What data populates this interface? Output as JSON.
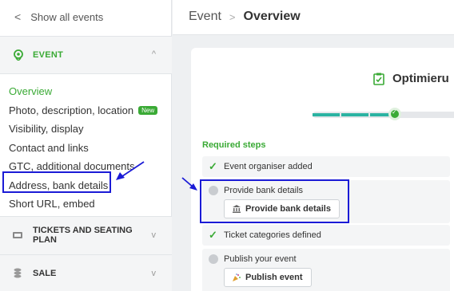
{
  "sidebar": {
    "back_label": "Show all events",
    "event_section": "EVENT",
    "menu": [
      {
        "label": "Overview",
        "active": true
      },
      {
        "label": "Photo, description, location",
        "badge": "New"
      },
      {
        "label": "Visibility, display"
      },
      {
        "label": "Contact and links"
      },
      {
        "label": "GTC, additional documents"
      },
      {
        "label": "Address, bank details"
      },
      {
        "label": "Short URL, embed"
      }
    ],
    "tickets_section": "TICKETS AND SEATING PLAN",
    "sale_section": "SALE"
  },
  "header": {
    "breadcrumb_parent": "Event",
    "breadcrumb_current": "Overview"
  },
  "card": {
    "title": "Optimieru",
    "progress_fraction": 0.52,
    "required_label": "Required steps",
    "steps": [
      {
        "label": "Event organiser added",
        "done": true
      },
      {
        "label": "Provide bank details",
        "done": false,
        "button": "Provide bank details"
      },
      {
        "label": "Ticket categories defined",
        "done": true
      },
      {
        "label": "Publish your event",
        "done": false,
        "button": "Publish event"
      }
    ]
  },
  "colors": {
    "accent_green": "#3aaa35",
    "progress_teal": "#2bb3a2",
    "highlight_blue": "#1b1bd6"
  }
}
